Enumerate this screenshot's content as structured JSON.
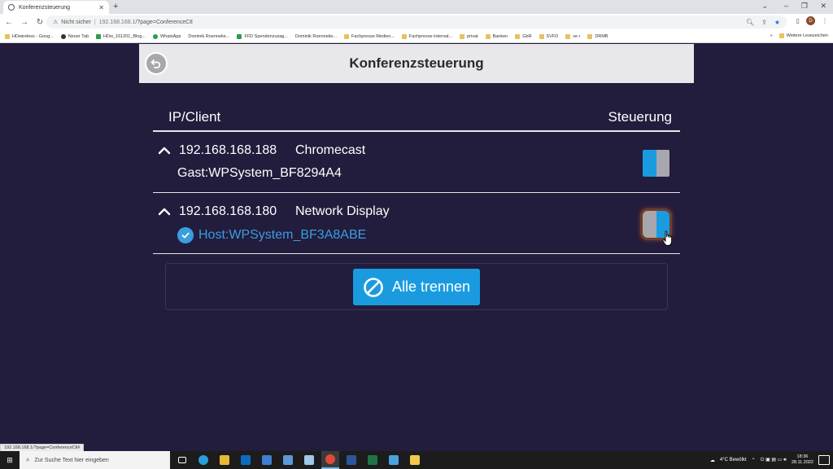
{
  "browser": {
    "tab_title": "Konferenzsteuerung",
    "url_warning": "Nicht sicher",
    "url_host": "192.168.168.1",
    "url_path": "/?page=ConferenceCtl",
    "bookmarks": [
      {
        "label": "HDwireless - Goog...",
        "icon": "folder"
      },
      {
        "label": "Neuer Tab",
        "icon": "dark"
      },
      {
        "label": "HDw_161201_Blog...",
        "icon": "green"
      },
      {
        "label": "WhatsApp",
        "icon": "green"
      },
      {
        "label": "Dominik Roenneke...",
        "icon": "none"
      },
      {
        "label": "FFD Spendenzusag...",
        "icon": "green"
      },
      {
        "label": "Dominik Roenneke...",
        "icon": "none"
      },
      {
        "label": "Fachpresse Medien...",
        "icon": "folder"
      },
      {
        "label": "Fachpresse internat...",
        "icon": "folder"
      },
      {
        "label": "privat",
        "icon": "folder"
      },
      {
        "label": "Banken",
        "icon": "folder"
      },
      {
        "label": "GbR",
        "icon": "folder"
      },
      {
        "label": "SVFD",
        "icon": "folder"
      },
      {
        "label": "ve r",
        "icon": "folder"
      },
      {
        "label": "DRMB",
        "icon": "folder"
      }
    ],
    "bookmarks_more": "»",
    "other_bookmarks": "Weitere Lesezeichen",
    "avatar_letter": "D",
    "status_url": "192.168.168.1/?page=ConferenceCtl#"
  },
  "app": {
    "title": "Konferenzsteuerung",
    "col_client": "IP/Client",
    "col_control": "Steuerung",
    "rows": [
      {
        "ip": "192.168.168.188",
        "type": "Chromecast",
        "client": "Gast:WPSystem_BF8294A4",
        "is_host": false,
        "toggle_left": "#1a9be0",
        "toggle_right": "#a7a7ad"
      },
      {
        "ip": "192.168.168.180",
        "type": "Network Display",
        "client": "Host:WPSystem_BF3A8ABE",
        "is_host": true,
        "toggle_left": "#a7a7ad",
        "toggle_right": "#1a9be0"
      }
    ],
    "disconnect_label": "Alle trennen",
    "accent": "#1a9be0",
    "background": "#221c3d"
  },
  "taskbar": {
    "search_placeholder": "Zur Suche Text hier eingeben",
    "weather": "4°C Bewölkt",
    "time": "18:36",
    "date": "28.11.2022"
  }
}
